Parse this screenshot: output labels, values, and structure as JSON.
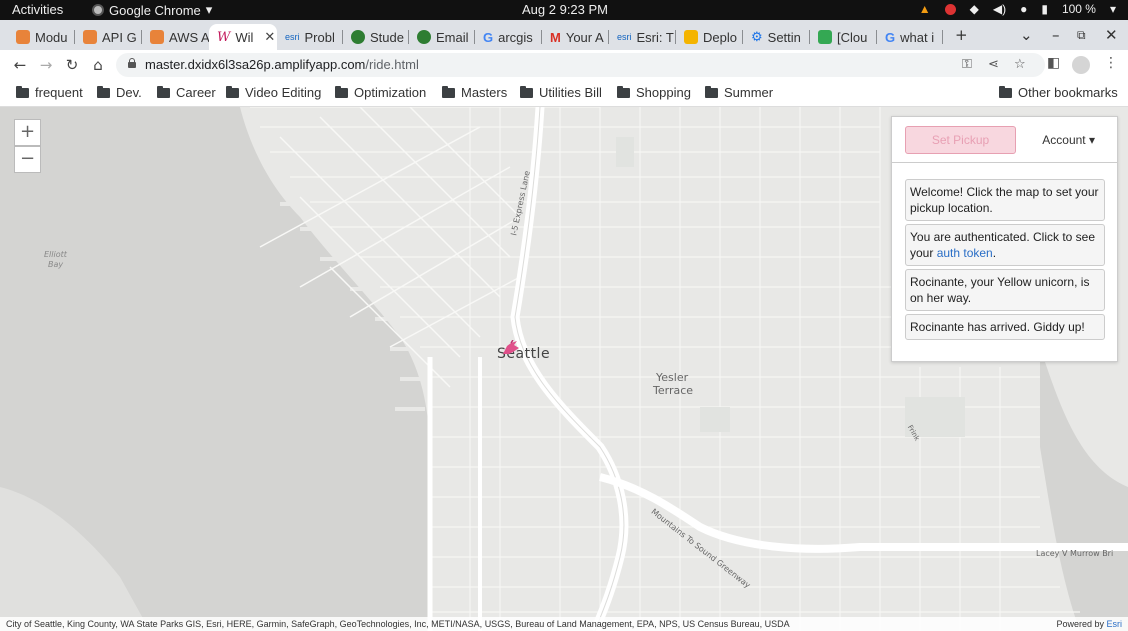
{
  "topbar": {
    "activities": "Activities",
    "app_name": "Google Chrome",
    "clock": "Aug 2  9:23 PM",
    "battery": "100 %"
  },
  "tabs": [
    {
      "label": "Modu",
      "color": "#e8833a"
    },
    {
      "label": "API G",
      "color": "#e8833a"
    },
    {
      "label": "AWS A",
      "color": "#e8833a"
    },
    {
      "label": "Wil",
      "color": "#c2185b",
      "active": true
    },
    {
      "label": "Probl",
      "color": "#1565c0"
    },
    {
      "label": "Stude",
      "color": "#2e7d32"
    },
    {
      "label": "Email",
      "color": "#2e7d32"
    },
    {
      "label": "arcgis",
      "color": "#4285f4"
    },
    {
      "label": "Your A",
      "color": "#d93025"
    },
    {
      "label": "Esri: T",
      "color": "#1565c0"
    },
    {
      "label": "Deplo",
      "color": "#f4b400"
    },
    {
      "label": "Settin",
      "color": "#1a73e8"
    },
    {
      "label": "[Clou",
      "color": "#34a853"
    },
    {
      "label": "what i",
      "color": "#4285f4"
    }
  ],
  "address": {
    "host": "master.dxidx6l3sa26p.amplifyapp.com",
    "path": "/ride.html"
  },
  "bookmarks": [
    "frequent",
    "Dev.",
    "Career",
    "Video Editing",
    "Optimization",
    "Masters",
    "Utilities Bill",
    "Shopping",
    "Summer"
  ],
  "other_bookmarks": "Other bookmarks",
  "map": {
    "zoom_in": "+",
    "zoom_out": "−",
    "labels": {
      "seattle": "Seattle",
      "yesler": "Yesler",
      "terrace": "Terrace",
      "express": "I-5 Express Lane",
      "mountains": "Mountains To Sound Greenway",
      "lacey": "Lacey V Murrow Bri",
      "elliott": "Elliott",
      "bay": "Bay",
      "frink": "Frink"
    },
    "attribution": "City of Seattle, King County, WA State Parks GIS, Esri, HERE, Garmin, SafeGraph, GeoTechnologies, Inc, METI/NASA, USGS, Bureau of Land Management, EPA, NPS, US Census Bureau, USDA",
    "powered_prefix": "Powered by ",
    "powered_link": "Esri"
  },
  "panel": {
    "pickup_button": "Set Pickup",
    "account": "Account",
    "messages": {
      "welcome": "Welcome! Click the map to set your pickup location.",
      "auth_prefix": "You are authenticated. Click to see your ",
      "auth_link": "auth token",
      "auth_suffix": ".",
      "unicorn": "Rocinante, your Yellow unicorn, is on her way.",
      "arrived": "Rocinante has arrived. Giddy up!"
    }
  }
}
